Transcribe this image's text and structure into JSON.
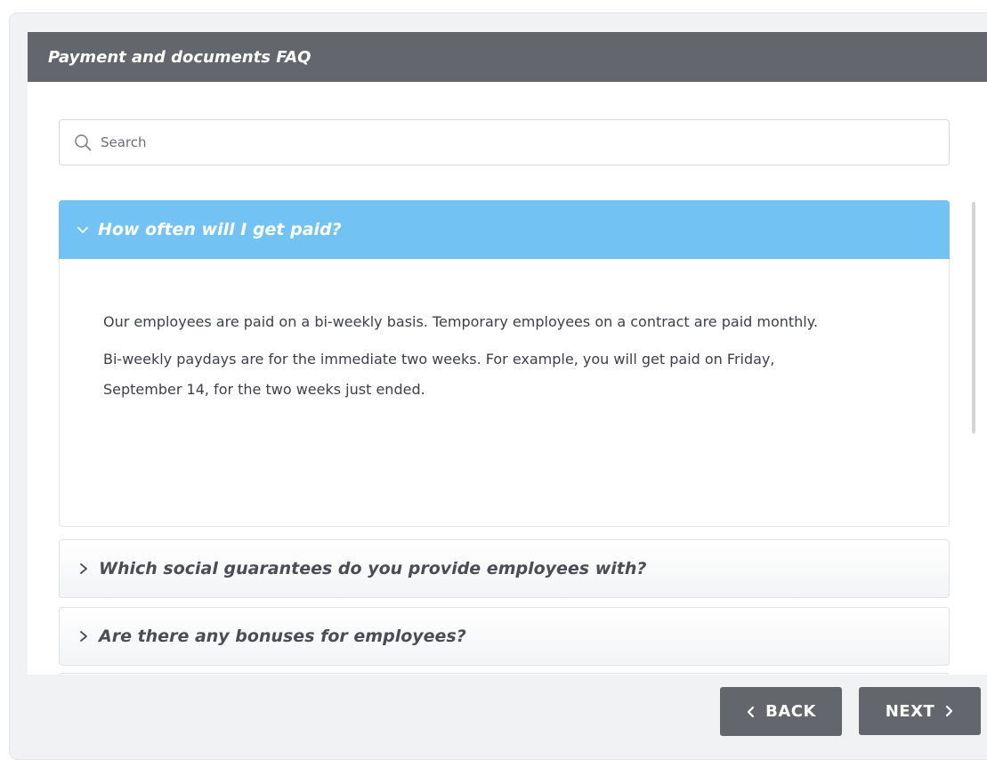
{
  "header": {
    "title": "Payment and documents FAQ"
  },
  "search": {
    "placeholder": "Search",
    "value": ""
  },
  "faq": {
    "items": [
      {
        "question": "How often will I get paid?",
        "expanded": true,
        "answer": [
          "Our employees are paid on a bi-weekly basis. Temporary employees on a contract are paid monthly.",
          "Bi-weekly paydays are for the immediate two weeks. For example, you will get paid on Friday, September 14, for the two weeks just ended."
        ]
      },
      {
        "question": "Which social guarantees do you provide employees with?",
        "expanded": false
      },
      {
        "question": "Are there any bonuses for employees?",
        "expanded": false
      }
    ]
  },
  "navigation": {
    "back_label": "BACK",
    "next_label": "NEXT"
  },
  "icons": {
    "search": "search-icon",
    "expanded": "chevron-down-icon",
    "collapsed": "chevron-right-icon",
    "back": "chevron-left-icon",
    "next": "chevron-right-icon"
  },
  "colors": {
    "header_bg": "#63666d",
    "active_item_bg": "#72c3f4",
    "button_bg": "#63666d"
  }
}
